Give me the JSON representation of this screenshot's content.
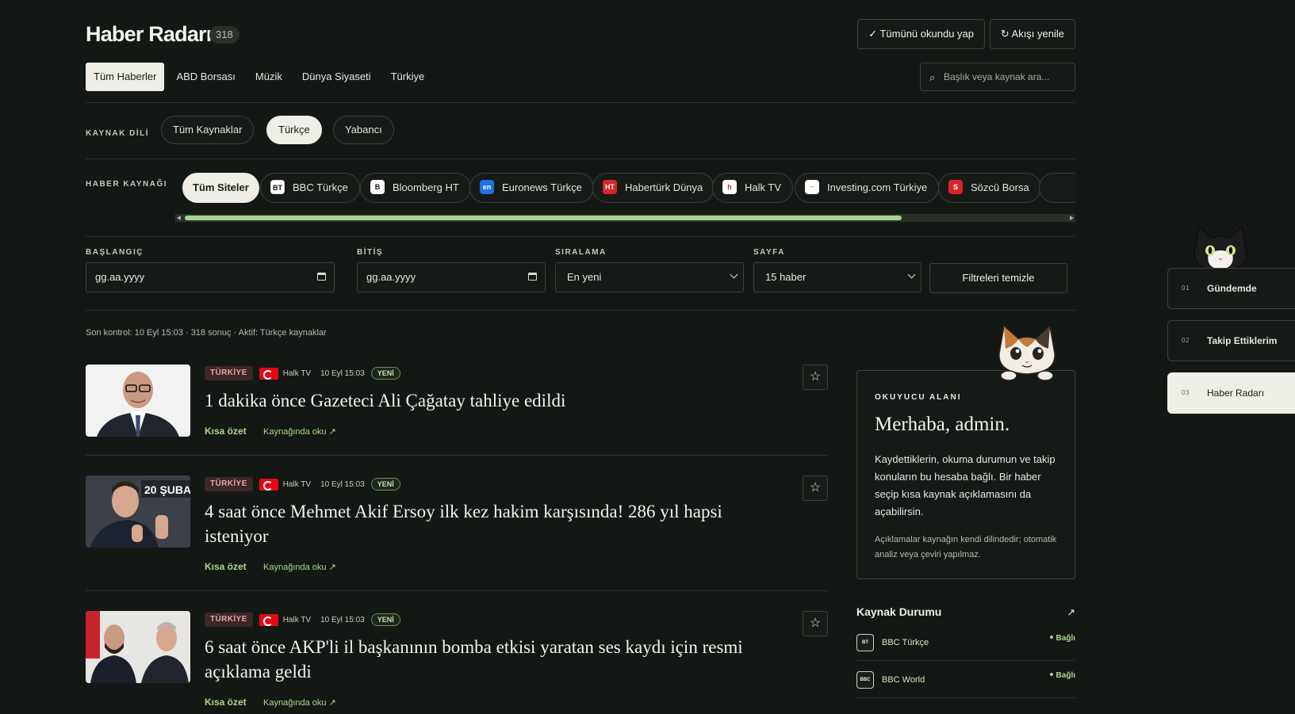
{
  "header": {
    "title": "Haber Radarı",
    "count": "318",
    "mark_all_read": "✓ Tümünü okundu yap",
    "refresh": "↻ Akışı yenile"
  },
  "tabs": [
    {
      "label": "Tüm Haberler",
      "active": true
    },
    {
      "label": "ABD Borsası"
    },
    {
      "label": "Müzik"
    },
    {
      "label": "Dünya Siyaseti"
    },
    {
      "label": "Türkiye"
    }
  ],
  "search": {
    "placeholder": "Başlık veya kaynak ara...",
    "icon": "search-icon"
  },
  "language": {
    "label": "KAYNAK DİLİ",
    "options": [
      "Tüm Kaynaklar",
      "Türkçe",
      "Yabancı"
    ],
    "selected": "Türkçe"
  },
  "sources": {
    "label": "HABER KAYNAĞI",
    "chips": [
      {
        "label": "Tüm Siteler",
        "active": true
      },
      {
        "label": "BBC Türkçe",
        "icon_text": "BT",
        "icon_bg": "#ffffff",
        "icon_fg": "#111111"
      },
      {
        "label": "Bloomberg HT",
        "icon_text": "B",
        "icon_bg": "#ffffff",
        "icon_fg": "#111111"
      },
      {
        "label": "Euronews Türkçe",
        "icon_text": "en",
        "icon_bg": "#1a73e8",
        "icon_fg": "#ffffff"
      },
      {
        "label": "Habertürk Dünya",
        "icon_text": "HT",
        "icon_bg": "#d7262b",
        "icon_fg": "#ffffff"
      },
      {
        "label": "Halk TV",
        "icon_text": "h",
        "icon_bg": "#ffffff",
        "icon_fg": "#d7262b"
      },
      {
        "label": "Investing.com Türkiye",
        "icon_text": "~",
        "icon_bg": "#ffffff",
        "icon_fg": "#e69a1f"
      },
      {
        "label": "Sözcü Borsa",
        "icon_text": "S",
        "icon_bg": "#d7262b",
        "icon_fg": "#ffffff"
      }
    ]
  },
  "filters": {
    "start_label": "BAŞLANGIÇ",
    "start_value": "gg.aa.yyyy",
    "end_label": "BİTİŞ",
    "end_value": "gg.aa.yyyy",
    "sort_label": "SIRALAMA",
    "sort_value": "En yeni",
    "page_label": "SAYFA",
    "page_value": "15 haber",
    "clear": "Filtreleri temizle"
  },
  "status_line": "Son kontrol: 10 Eyl 15:03 · 318 sonuç · Aktif: Türkçe kaynaklar",
  "articles": [
    {
      "tag": "TÜRKİYE",
      "source": "Halk TV",
      "time": "10 Eyl 15:03",
      "badge": "YENİ",
      "headline": "1 dakika önce Gazeteci Ali Çağatay tahliye edildi",
      "summary": "Kısa özet",
      "read_source": "Kaynağında oku ↗"
    },
    {
      "tag": "TÜRKİYE",
      "source": "Halk TV",
      "time": "10 Eyl 15:03",
      "badge": "YENİ",
      "headline": "4 saat önce Mehmet Akif Ersoy ilk kez hakim karşısında! 286 yıl hapsi isteniyor",
      "summary": "Kısa özet",
      "read_source": "Kaynağında oku ↗",
      "image_caption": "20 ŞUBAT"
    },
    {
      "tag": "TÜRKİYE",
      "source": "Halk TV",
      "time": "10 Eyl 15:03",
      "badge": "YENİ",
      "headline": "6 saat önce AKP'li il başkanının bomba etkisi yaratan ses kaydı için resmi açıklama geldi",
      "summary": "Kısa özet",
      "read_source": "Kaynağında oku ↗"
    }
  ],
  "reader": {
    "label": "OKUYUCU ALANI",
    "greeting": "Merhaba, admin.",
    "body": "Kaydettiklerin, okuma durumun ve takip konuların bu hesaba bağlı. Bir haber seçip kısa kaynak açıklamasını da açabilirsin.",
    "note": "Açıklamalar kaynağın kendi dilindedir; otomatik analiz veya çeviri yapılmaz."
  },
  "source_status": {
    "title": "Kaynak Durumu",
    "arrow": "↗",
    "rows": [
      {
        "name": "BBC Türkçe",
        "icon_text": "BT",
        "status": "Bağlı"
      },
      {
        "name": "BBC World",
        "icon_text": "BBC",
        "status": "Bağlı"
      }
    ]
  },
  "sidenav": [
    {
      "num": "01",
      "label": "Gündemde"
    },
    {
      "num": "02",
      "label": "Takip Ettiklerim"
    },
    {
      "num": "03",
      "label": "Haber Radarı",
      "active": true
    }
  ],
  "colors": {
    "background": "#141815",
    "accent_green": "#a9d78d",
    "tag_red": "#e5a8a3"
  }
}
